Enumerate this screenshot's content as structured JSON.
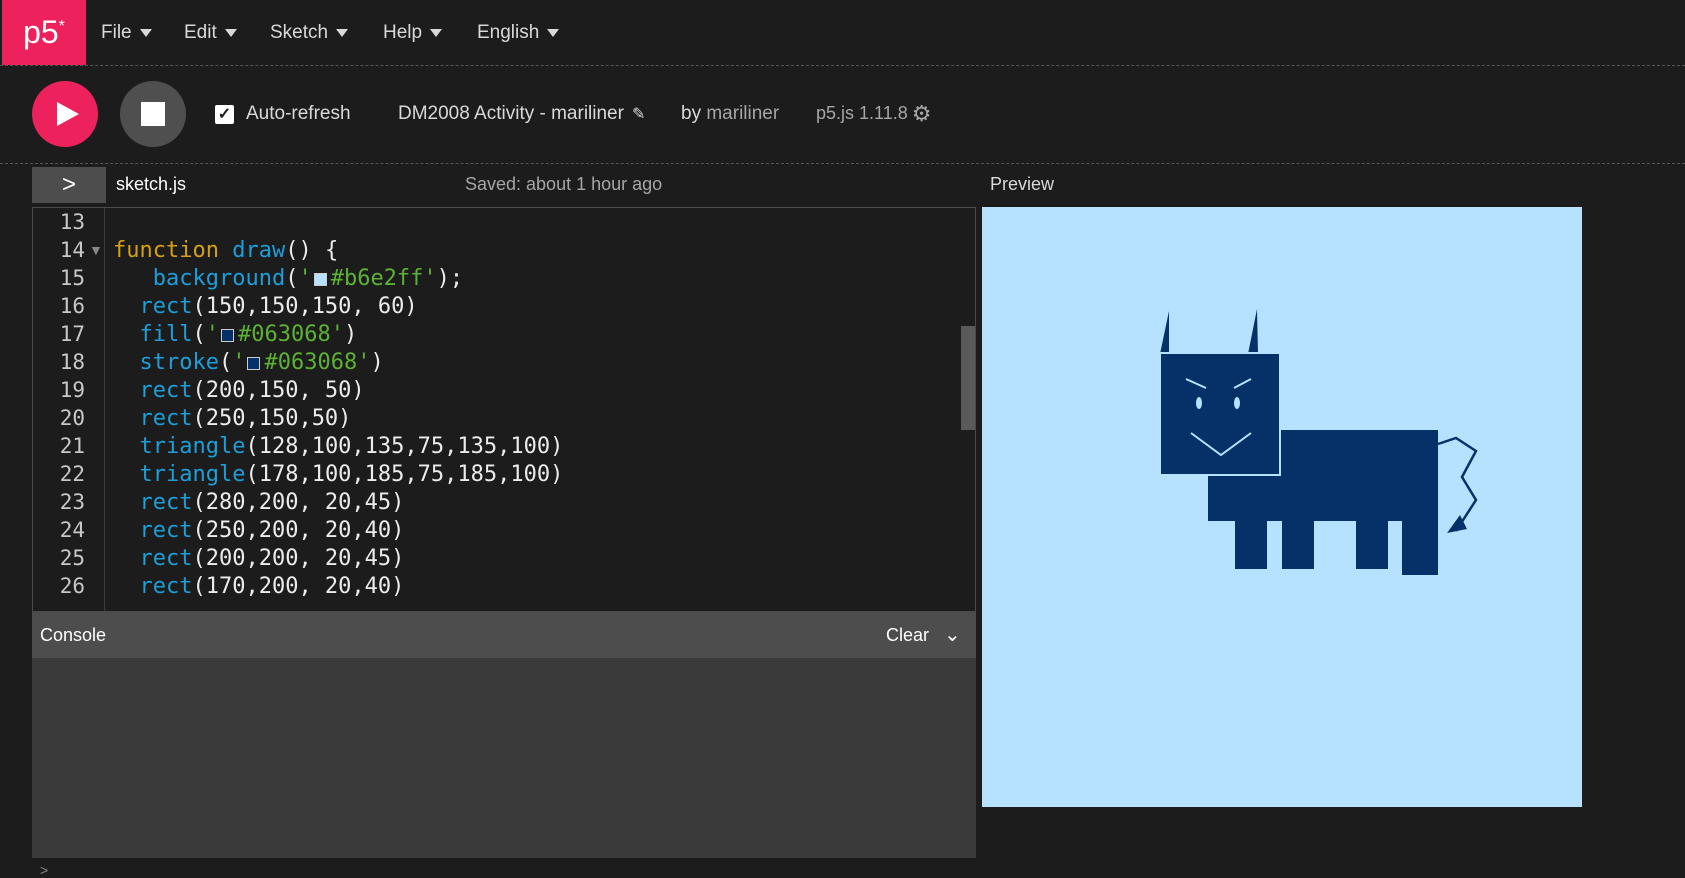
{
  "nav": {
    "logo": "p5",
    "logo_star": "*",
    "menus": [
      "File",
      "Edit",
      "Sketch",
      "Help",
      "English"
    ]
  },
  "toolbar": {
    "auto_refresh_label": "Auto-refresh",
    "auto_refresh_checked": true,
    "sketch_name": "DM2008 Activity - mariliner",
    "by_label": "by",
    "author": "mariliner",
    "version": "p5.js 1.11.8"
  },
  "editor": {
    "sidebar_toggle": ">",
    "filename": "sketch.js",
    "saved_status": "Saved: about 1 hour ago",
    "lines": [
      {
        "num": "13",
        "text": ""
      },
      {
        "num": "14",
        "text": "function draw() {"
      },
      {
        "num": "15",
        "text": "   background('#b6e2ff');"
      },
      {
        "num": "16",
        "text": "  rect(150,150,150, 60)"
      },
      {
        "num": "17",
        "text": "  fill('#063068')"
      },
      {
        "num": "18",
        "text": "  stroke('#063068')"
      },
      {
        "num": "19",
        "text": "  rect(200,150, 50)"
      },
      {
        "num": "20",
        "text": "  rect(250,150,50)"
      },
      {
        "num": "21",
        "text": "  triangle(128,100,135,75,135,100)"
      },
      {
        "num": "22",
        "text": "  triangle(178,100,185,75,185,100)"
      },
      {
        "num": "23",
        "text": "  rect(280,200, 20,45)"
      },
      {
        "num": "24",
        "text": "  rect(250,200, 20,40)"
      },
      {
        "num": "25",
        "text": "  rect(200,200, 20,45)"
      },
      {
        "num": "26",
        "text": "  rect(170,200, 20,40)"
      }
    ]
  },
  "console": {
    "title": "Console",
    "clear_label": "Clear",
    "prompt": ">"
  },
  "preview": {
    "label": "Preview",
    "background_color": "#b6e2ff",
    "fill_color": "#063068"
  },
  "colors": {
    "accent": "#ed225d",
    "keyword": "#d4a017",
    "function": "#1e9ed8",
    "string": "#5cb234"
  }
}
